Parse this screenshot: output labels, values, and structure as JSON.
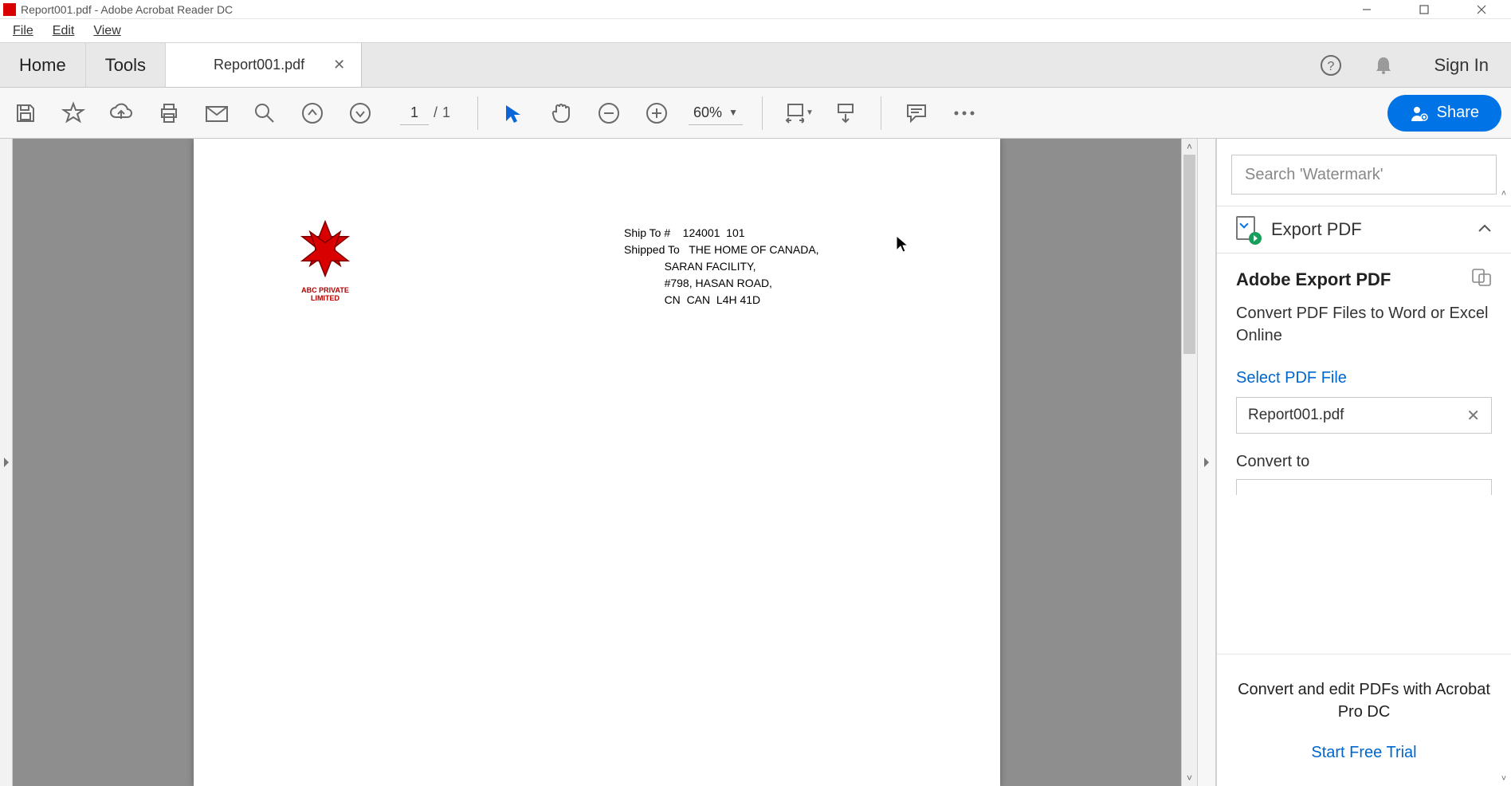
{
  "window": {
    "title": "Report001.pdf - Adobe Acrobat Reader DC"
  },
  "menu": {
    "file": "File",
    "edit": "Edit",
    "view": "View"
  },
  "tabs": {
    "home": "Home",
    "tools": "Tools",
    "doc_label": "Report001.pdf",
    "sign_in": "Sign In"
  },
  "toolbar": {
    "page_current": "1",
    "page_sep": "/",
    "page_total": "1",
    "zoom": "60%",
    "share": "Share"
  },
  "right_panel": {
    "search_placeholder": "Search 'Watermark'",
    "export_header": "Export PDF",
    "export_title": "Adobe Export PDF",
    "export_desc": "Convert PDF Files to Word or Excel Online",
    "select_label": "Select PDF File",
    "selected_file": "Report001.pdf",
    "convert_to_label": "Convert to",
    "promo_line": "Convert and edit PDFs with Acrobat Pro DC",
    "trial_link": "Start Free Trial"
  },
  "pdf": {
    "company_caption": "ABC PRIVATE LIMITED",
    "ship_block": "Ship To #    124001  101\nShipped To   THE HOME OF CANADA,\n             SARAN FACILITY,\n             #798, HASAN ROAD,\n             CN  CAN  L4H 41D"
  }
}
